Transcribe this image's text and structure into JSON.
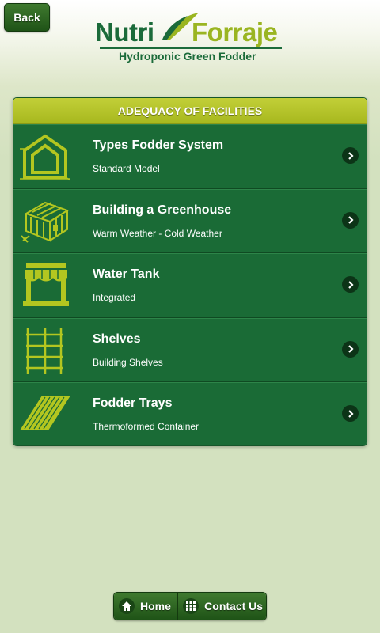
{
  "header": {
    "back_label": "Back",
    "logo": {
      "word1": "Nutri",
      "word2": "Forraje",
      "tagline": "Hydroponic Green Fodder"
    }
  },
  "panel": {
    "title": "ADEQUACY OF FACILITIES",
    "items": [
      {
        "title": "Types Fodder System",
        "subtitle": "Standard Model",
        "icon": "house-frame-icon"
      },
      {
        "title": "Building a Greenhouse",
        "subtitle": "Warm Weather - Cold Weather",
        "icon": "greenhouse-icon"
      },
      {
        "title": "Water Tank",
        "subtitle": "Integrated",
        "icon": "water-tank-icon"
      },
      {
        "title": "Shelves",
        "subtitle": "Building Shelves",
        "icon": "shelves-icon"
      },
      {
        "title": "Fodder Trays",
        "subtitle": "Thermoformed Container",
        "icon": "tray-icon"
      }
    ]
  },
  "footer": {
    "home_label": "Home",
    "contact_label": "Contact Us"
  },
  "colors": {
    "brand_green": "#1a6b36",
    "accent_lime": "#a7b81e",
    "icon_color": "#b3c620"
  }
}
